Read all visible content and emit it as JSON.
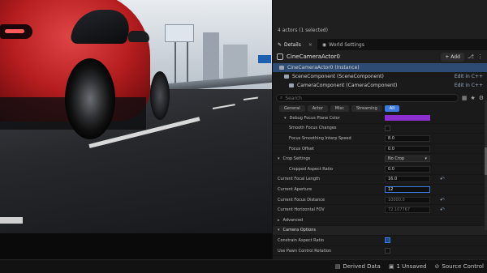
{
  "outliner": {
    "actors_status": "4 actors (1 selected)"
  },
  "tabs": [
    {
      "label": "Details",
      "icon": "pencil-icon",
      "close": "✕"
    },
    {
      "label": "World Settings",
      "icon": "globe-icon"
    }
  ],
  "actor": {
    "name": "CineCameraActor0",
    "add_label": "+ Add"
  },
  "components": [
    {
      "label": "CineCameraActor0 (Instance)",
      "edit": ""
    },
    {
      "label": "SceneComponent (SceneComponent)",
      "edit": "Edit in C++"
    },
    {
      "label": "CameraComponent (CameraComponent)",
      "edit": "Edit in C++"
    }
  ],
  "search": {
    "placeholder": "Search"
  },
  "filters": [
    "General",
    "Actor",
    "Misc",
    "Streaming",
    "All"
  ],
  "properties": {
    "debug_focus_plane_color": "Debug Focus Plane Color",
    "smooth_focus_changes": "Smooth Focus Changes",
    "focus_smoothing_interp_speed": {
      "label": "Focus Smoothing Interp Speed",
      "value": "8.0"
    },
    "focus_offset": {
      "label": "Focus Offset",
      "value": "0.0"
    },
    "crop_settings": {
      "label": "Crop Settings",
      "value": "No Crop"
    },
    "cropped_aspect_ratio": {
      "label": "Cropped Aspect Ratio",
      "value": "0.0"
    },
    "current_focal_length": {
      "label": "Current Focal Length",
      "value": "16.0"
    },
    "current_aperture": {
      "label": "Current Aperture",
      "value": "12"
    },
    "current_focus_distance": {
      "label": "Current Focus Distance",
      "value": "10000.0"
    },
    "current_horizontal_fov": {
      "label": "Current Horizontal FOV",
      "value": "72.107767"
    },
    "advanced": "Advanced",
    "camera_options": "Camera Options",
    "constrain_aspect_ratio": "Constrain Aspect Ratio",
    "use_pawn_control_rotation": "Use Pawn Control Rotation"
  },
  "status": {
    "derived_data": "Derived Data",
    "unsaved": "1 Unsaved",
    "source_control": "Source Control"
  },
  "colors": {
    "accent": "#3d7be0",
    "selection": "#2e4c73",
    "swatch": "#8b2fd0"
  }
}
